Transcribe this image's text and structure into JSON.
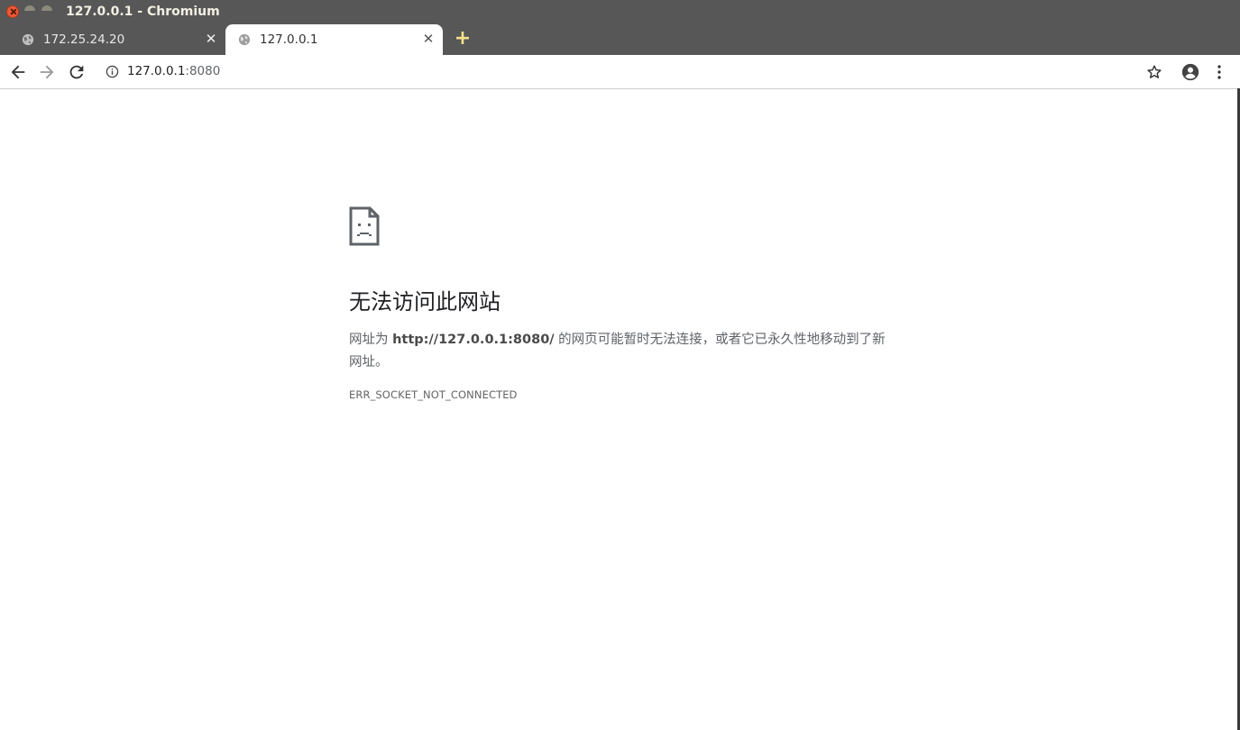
{
  "window": {
    "title": "127.0.0.1 - Chromium"
  },
  "tabs": [
    {
      "title": "172.25.24.20",
      "active": false,
      "icon": "globe-icon"
    },
    {
      "title": "127.0.0.1",
      "active": true,
      "icon": "globe-icon"
    }
  ],
  "toolbar": {
    "url_host": "127.0.0.1",
    "url_port": ":8080"
  },
  "error": {
    "heading": "无法访问此网站",
    "desc_prefix": "网址为 ",
    "desc_url": "http://127.0.0.1:8080/",
    "desc_suffix": " 的网页可能暂时无法连接，或者它已永久性地移动到了新网址。",
    "code": "ERR_SOCKET_NOT_CONNECTED"
  },
  "colors": {
    "titlebar": "#575757",
    "close_button": "#ef5b36",
    "new_tab_plus": "#f7e28a",
    "text_primary": "#202124",
    "text_secondary": "#5f6368"
  }
}
